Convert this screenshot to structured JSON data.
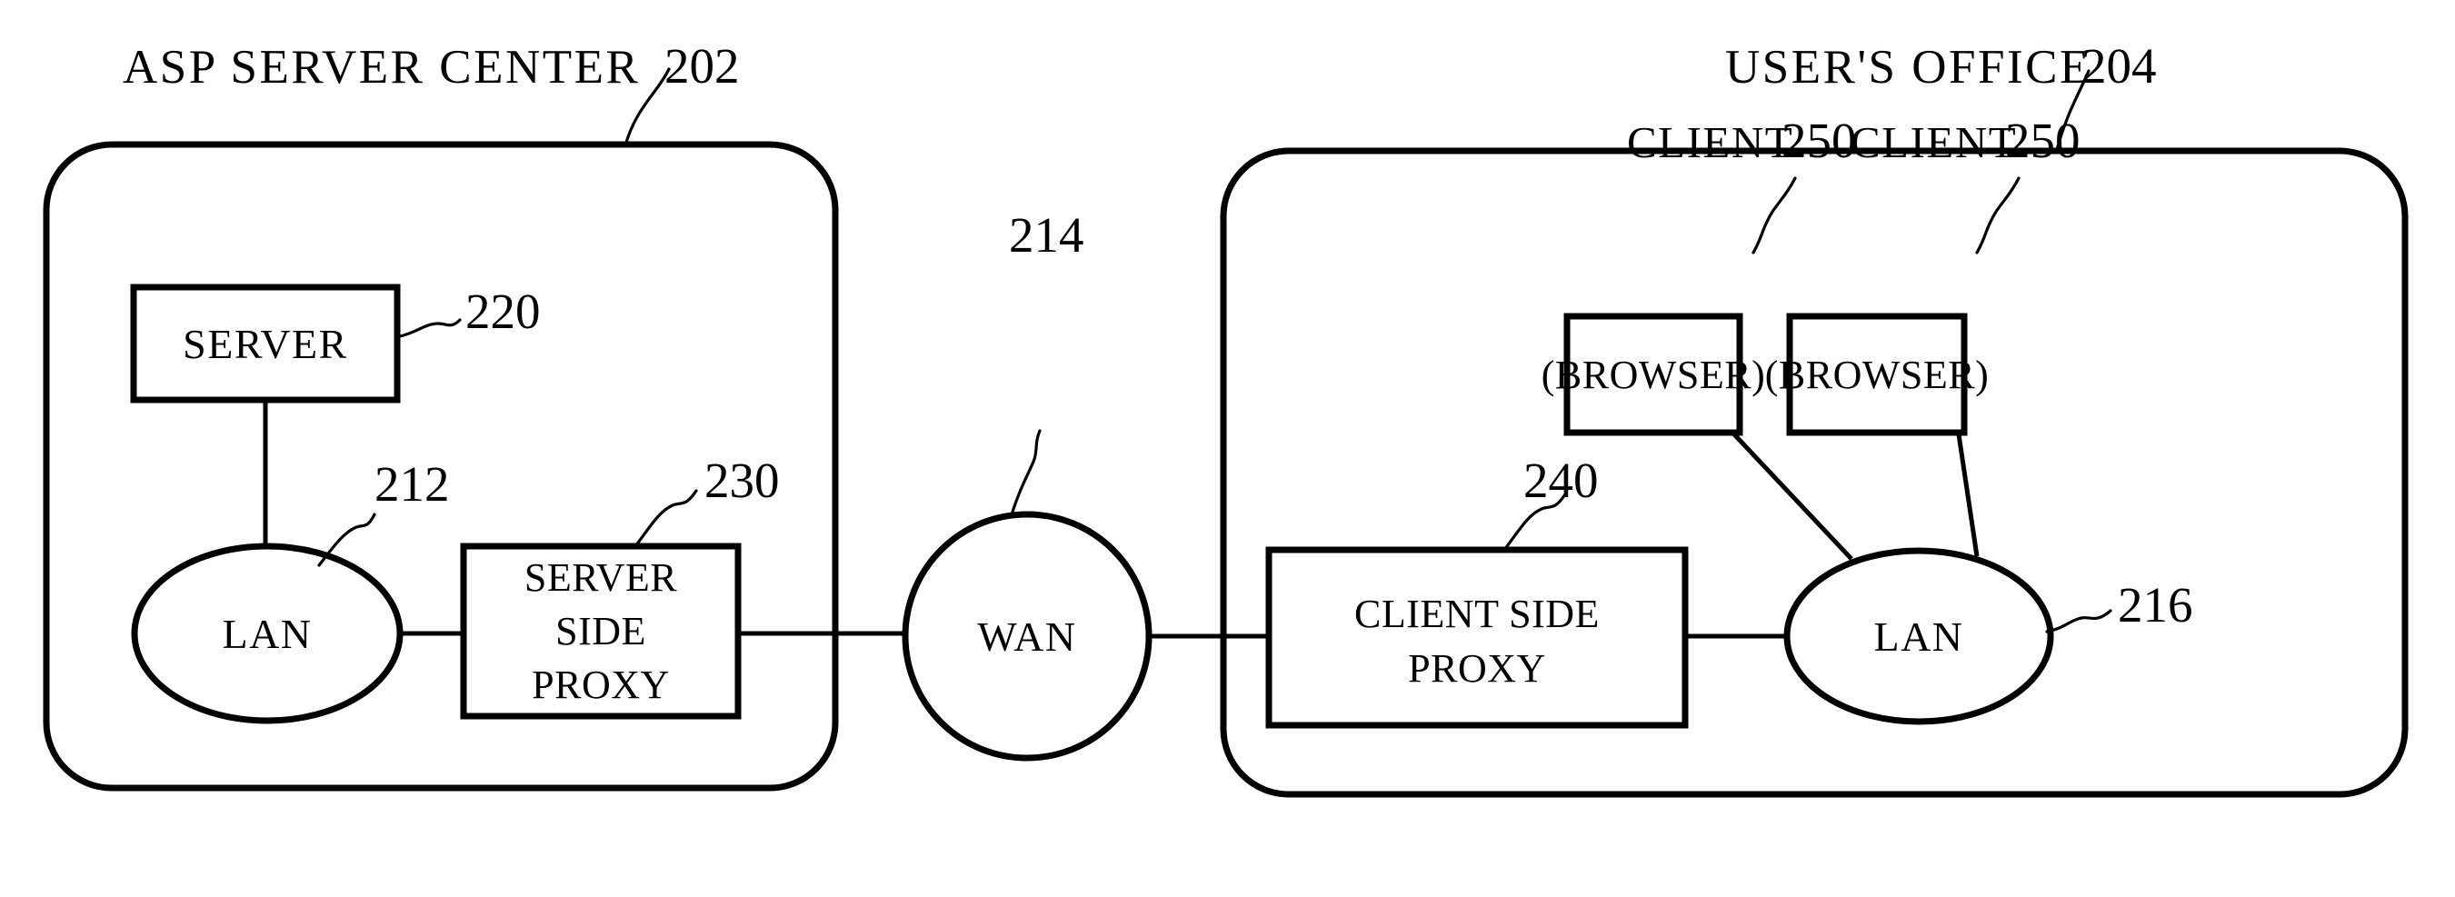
{
  "figure": {
    "kind": "network-architecture-diagram",
    "background_color": "#ffffff",
    "line_color": "#000000"
  },
  "panels": [
    {
      "id": "asp-server-center",
      "title": "ASP  SERVER  CENTER",
      "ref": "202"
    },
    {
      "id": "users-office",
      "title": "USER'S  OFFICE",
      "ref": "204"
    }
  ],
  "nodes": {
    "server": {
      "label": "SERVER",
      "ref": "220"
    },
    "lan_left": {
      "label": "LAN",
      "ref": "212"
    },
    "server_side_proxy": {
      "line1": "SERVER",
      "line2": "SIDE",
      "line3": "PROXY",
      "ref": "230"
    },
    "wan": {
      "label": "WAN",
      "ref": "214"
    },
    "client_side_proxy": {
      "line1": "CLIENT  SIDE",
      "line2": "PROXY",
      "ref": "240"
    },
    "lan_right": {
      "label": "LAN",
      "ref": "216"
    },
    "client_one": {
      "title": "CLIENT",
      "ref": "250",
      "label": "(BROWSER)"
    },
    "client_two": {
      "title": "CLIENT",
      "ref": "250",
      "label": "(BROWSER)"
    }
  }
}
